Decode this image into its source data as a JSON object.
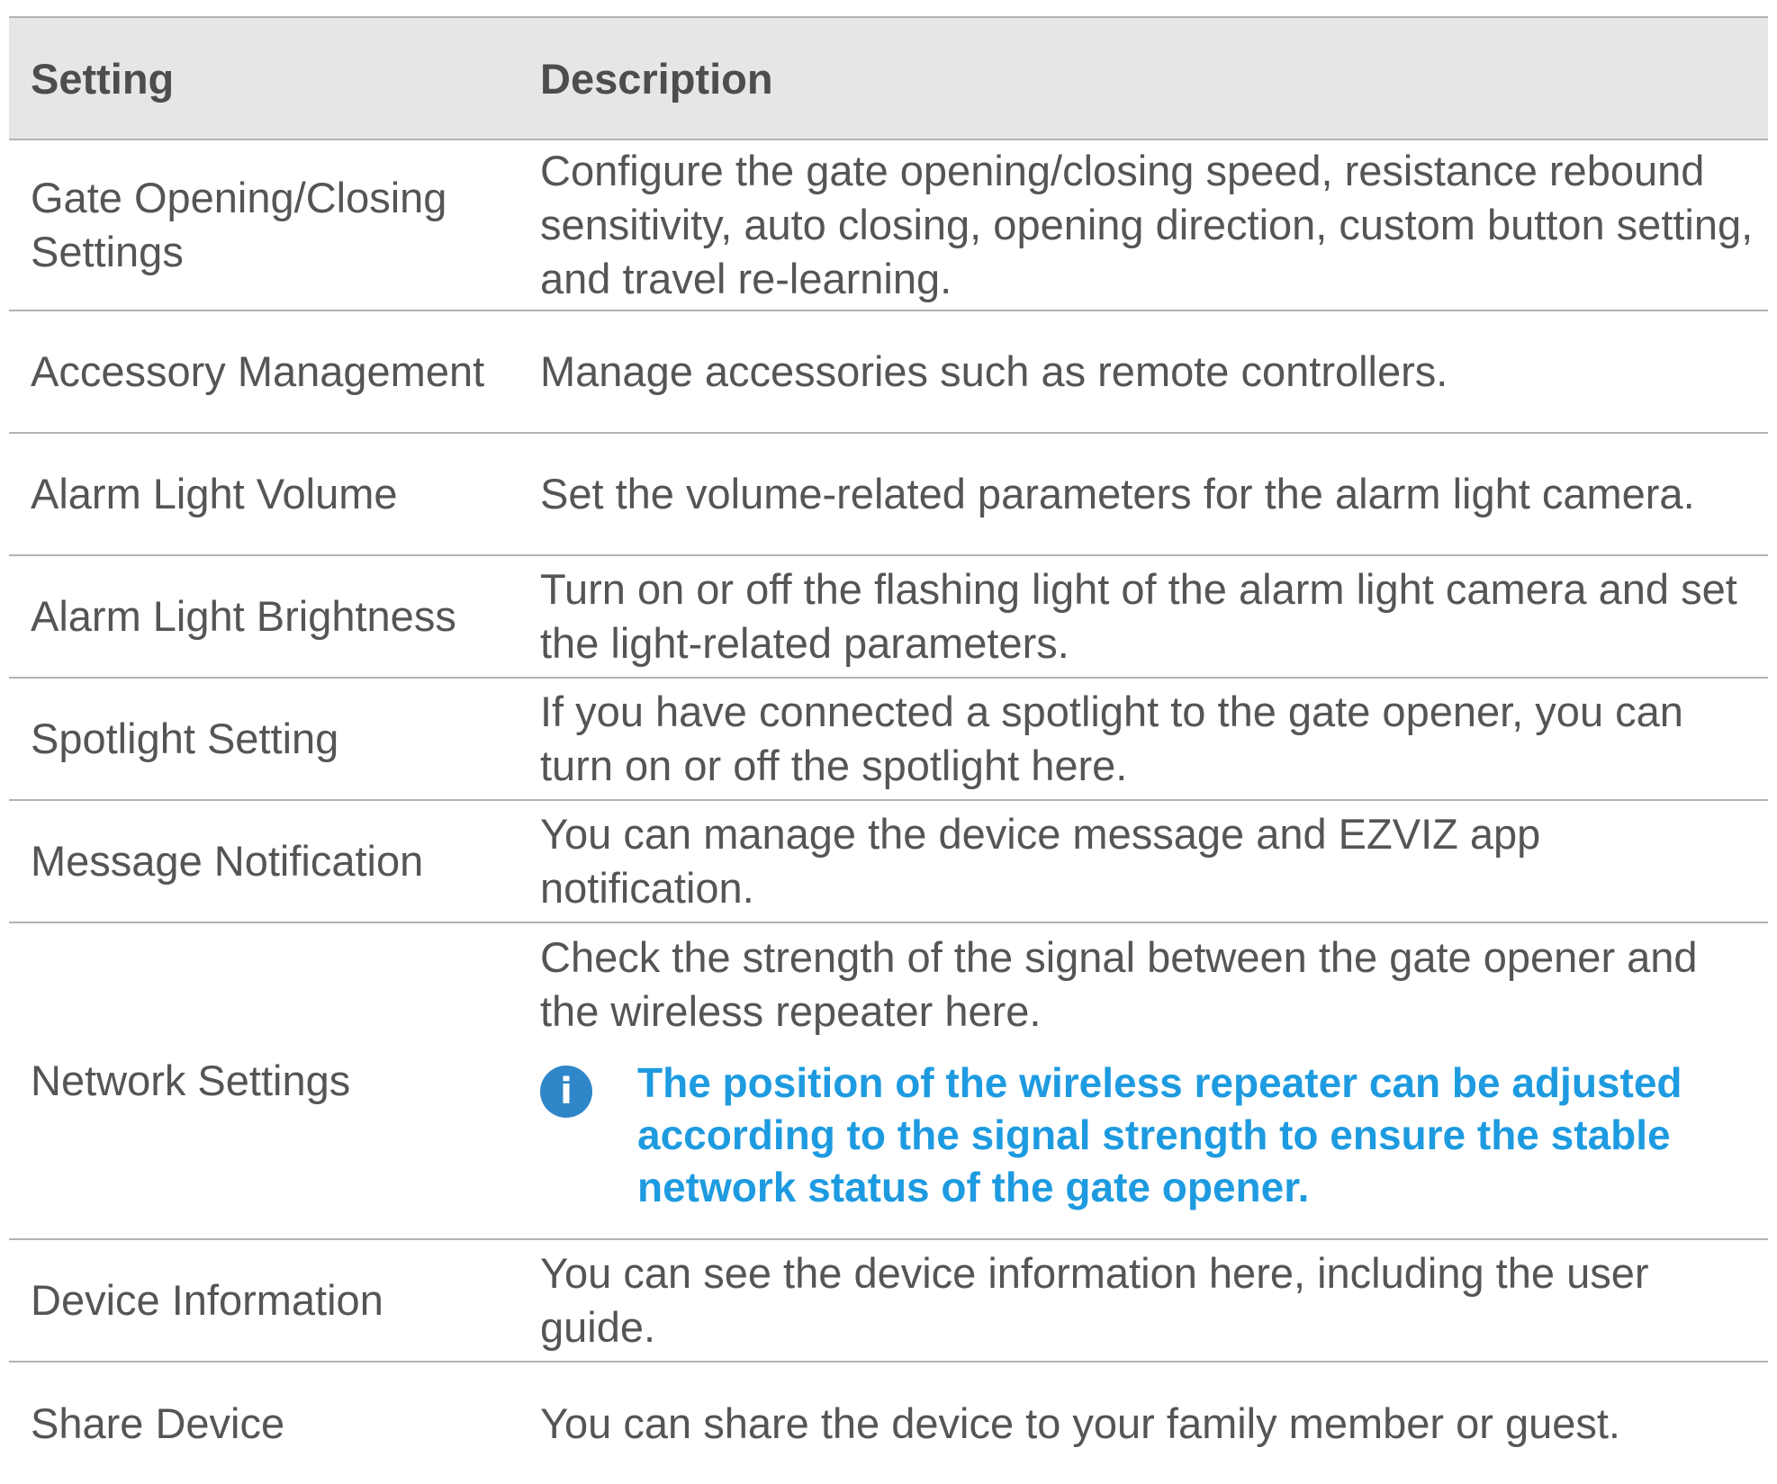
{
  "table": {
    "headers": {
      "setting": "Setting",
      "description": "Description"
    },
    "rows": [
      {
        "setting": "Gate Opening/Closing Settings",
        "description": "Configure the gate opening/closing speed, resistance rebound sensitivity, auto closing, opening direction, custom button setting, and travel re-learning."
      },
      {
        "setting": "Accessory Management",
        "description": "Manage accessories such as remote controllers."
      },
      {
        "setting": "Alarm Light Volume",
        "description": "Set the volume-related parameters for the alarm light camera."
      },
      {
        "setting": "Alarm Light Brightness",
        "description": "Turn on or off the flashing light of the alarm light camera and set the light-related parameters."
      },
      {
        "setting": "Spotlight Setting",
        "description": "If you have connected a spotlight to the gate opener, you can turn on or off the spotlight here."
      },
      {
        "setting": "Message Notification",
        "description": "You can manage the device message and EZVIZ app notification."
      },
      {
        "setting": "Network Settings",
        "description": "Check the strength of the signal between the gate opener and the wireless repeater here.",
        "note": "The position of the wireless repeater can be adjusted according to the signal strength to ensure the stable network status of the gate opener."
      },
      {
        "setting": "Device Information",
        "description": "You can see the device information here, including the user guide."
      },
      {
        "setting": "Share Device",
        "description": "You can share the device to your family member or guest."
      }
    ]
  },
  "icons": {
    "note_icon": "info-icon",
    "note_icon_glyph": "i"
  },
  "colors": {
    "header_background": "#e6e6e6",
    "body_text": "#555555",
    "note_text": "#1e9be0",
    "info_icon": "#2f86c9",
    "divider": "#b3b3b3"
  }
}
